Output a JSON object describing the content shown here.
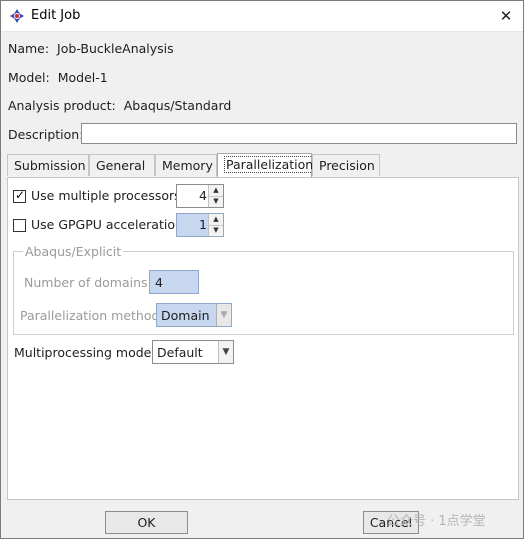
{
  "window": {
    "title": "Edit Job"
  },
  "info": {
    "name_label": "Name:",
    "name_value": "Job-BuckleAnalysis",
    "model_label": "Model:",
    "model_value": "Model-1",
    "product_label": "Analysis product:",
    "product_value": "Abaqus/Standard",
    "description_label": "Description:",
    "description_value": ""
  },
  "tabs": [
    "Submission",
    "General",
    "Memory",
    "Parallelization",
    "Precision"
  ],
  "active_tab": "Parallelization",
  "parallel": {
    "multi_proc_label": "Use multiple processors",
    "multi_proc_checked": true,
    "processors": "4",
    "gpgpu_label": "Use GPGPU acceleration",
    "gpgpu_checked": false,
    "gpgpu_value": "1",
    "explicit_group_label": "Abaqus/Explicit",
    "domains_label": "Number of domains:",
    "domains_value": "4",
    "method_label": "Parallelization method:",
    "method_value": "Domain",
    "mode_label": "Multiprocessing mode:",
    "mode_value": "Default"
  },
  "buttons": {
    "ok": "OK",
    "cancel": "Cancel"
  },
  "watermark": "公众号 · 1点学堂",
  "icons": {
    "title": "abaqus-logo-icon",
    "close": "close-icon"
  }
}
